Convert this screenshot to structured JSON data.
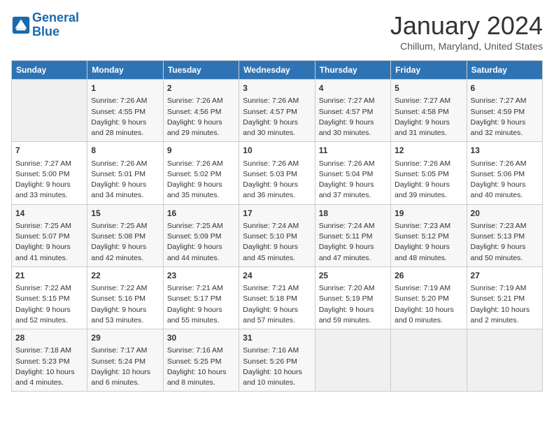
{
  "header": {
    "logo_line1": "General",
    "logo_line2": "Blue",
    "month": "January 2024",
    "location": "Chillum, Maryland, United States"
  },
  "columns": [
    "Sunday",
    "Monday",
    "Tuesday",
    "Wednesday",
    "Thursday",
    "Friday",
    "Saturday"
  ],
  "weeks": [
    [
      {
        "day": "",
        "info": ""
      },
      {
        "day": "1",
        "info": "Sunrise: 7:26 AM\nSunset: 4:55 PM\nDaylight: 9 hours\nand 28 minutes."
      },
      {
        "day": "2",
        "info": "Sunrise: 7:26 AM\nSunset: 4:56 PM\nDaylight: 9 hours\nand 29 minutes."
      },
      {
        "day": "3",
        "info": "Sunrise: 7:26 AM\nSunset: 4:57 PM\nDaylight: 9 hours\nand 30 minutes."
      },
      {
        "day": "4",
        "info": "Sunrise: 7:27 AM\nSunset: 4:57 PM\nDaylight: 9 hours\nand 30 minutes."
      },
      {
        "day": "5",
        "info": "Sunrise: 7:27 AM\nSunset: 4:58 PM\nDaylight: 9 hours\nand 31 minutes."
      },
      {
        "day": "6",
        "info": "Sunrise: 7:27 AM\nSunset: 4:59 PM\nDaylight: 9 hours\nand 32 minutes."
      }
    ],
    [
      {
        "day": "7",
        "info": "Sunrise: 7:27 AM\nSunset: 5:00 PM\nDaylight: 9 hours\nand 33 minutes."
      },
      {
        "day": "8",
        "info": "Sunrise: 7:26 AM\nSunset: 5:01 PM\nDaylight: 9 hours\nand 34 minutes."
      },
      {
        "day": "9",
        "info": "Sunrise: 7:26 AM\nSunset: 5:02 PM\nDaylight: 9 hours\nand 35 minutes."
      },
      {
        "day": "10",
        "info": "Sunrise: 7:26 AM\nSunset: 5:03 PM\nDaylight: 9 hours\nand 36 minutes."
      },
      {
        "day": "11",
        "info": "Sunrise: 7:26 AM\nSunset: 5:04 PM\nDaylight: 9 hours\nand 37 minutes."
      },
      {
        "day": "12",
        "info": "Sunrise: 7:26 AM\nSunset: 5:05 PM\nDaylight: 9 hours\nand 39 minutes."
      },
      {
        "day": "13",
        "info": "Sunrise: 7:26 AM\nSunset: 5:06 PM\nDaylight: 9 hours\nand 40 minutes."
      }
    ],
    [
      {
        "day": "14",
        "info": "Sunrise: 7:25 AM\nSunset: 5:07 PM\nDaylight: 9 hours\nand 41 minutes."
      },
      {
        "day": "15",
        "info": "Sunrise: 7:25 AM\nSunset: 5:08 PM\nDaylight: 9 hours\nand 42 minutes."
      },
      {
        "day": "16",
        "info": "Sunrise: 7:25 AM\nSunset: 5:09 PM\nDaylight: 9 hours\nand 44 minutes."
      },
      {
        "day": "17",
        "info": "Sunrise: 7:24 AM\nSunset: 5:10 PM\nDaylight: 9 hours\nand 45 minutes."
      },
      {
        "day": "18",
        "info": "Sunrise: 7:24 AM\nSunset: 5:11 PM\nDaylight: 9 hours\nand 47 minutes."
      },
      {
        "day": "19",
        "info": "Sunrise: 7:23 AM\nSunset: 5:12 PM\nDaylight: 9 hours\nand 48 minutes."
      },
      {
        "day": "20",
        "info": "Sunrise: 7:23 AM\nSunset: 5:13 PM\nDaylight: 9 hours\nand 50 minutes."
      }
    ],
    [
      {
        "day": "21",
        "info": "Sunrise: 7:22 AM\nSunset: 5:15 PM\nDaylight: 9 hours\nand 52 minutes."
      },
      {
        "day": "22",
        "info": "Sunrise: 7:22 AM\nSunset: 5:16 PM\nDaylight: 9 hours\nand 53 minutes."
      },
      {
        "day": "23",
        "info": "Sunrise: 7:21 AM\nSunset: 5:17 PM\nDaylight: 9 hours\nand 55 minutes."
      },
      {
        "day": "24",
        "info": "Sunrise: 7:21 AM\nSunset: 5:18 PM\nDaylight: 9 hours\nand 57 minutes."
      },
      {
        "day": "25",
        "info": "Sunrise: 7:20 AM\nSunset: 5:19 PM\nDaylight: 9 hours\nand 59 minutes."
      },
      {
        "day": "26",
        "info": "Sunrise: 7:19 AM\nSunset: 5:20 PM\nDaylight: 10 hours\nand 0 minutes."
      },
      {
        "day": "27",
        "info": "Sunrise: 7:19 AM\nSunset: 5:21 PM\nDaylight: 10 hours\nand 2 minutes."
      }
    ],
    [
      {
        "day": "28",
        "info": "Sunrise: 7:18 AM\nSunset: 5:23 PM\nDaylight: 10 hours\nand 4 minutes."
      },
      {
        "day": "29",
        "info": "Sunrise: 7:17 AM\nSunset: 5:24 PM\nDaylight: 10 hours\nand 6 minutes."
      },
      {
        "day": "30",
        "info": "Sunrise: 7:16 AM\nSunset: 5:25 PM\nDaylight: 10 hours\nand 8 minutes."
      },
      {
        "day": "31",
        "info": "Sunrise: 7:16 AM\nSunset: 5:26 PM\nDaylight: 10 hours\nand 10 minutes."
      },
      {
        "day": "",
        "info": ""
      },
      {
        "day": "",
        "info": ""
      },
      {
        "day": "",
        "info": ""
      }
    ]
  ]
}
